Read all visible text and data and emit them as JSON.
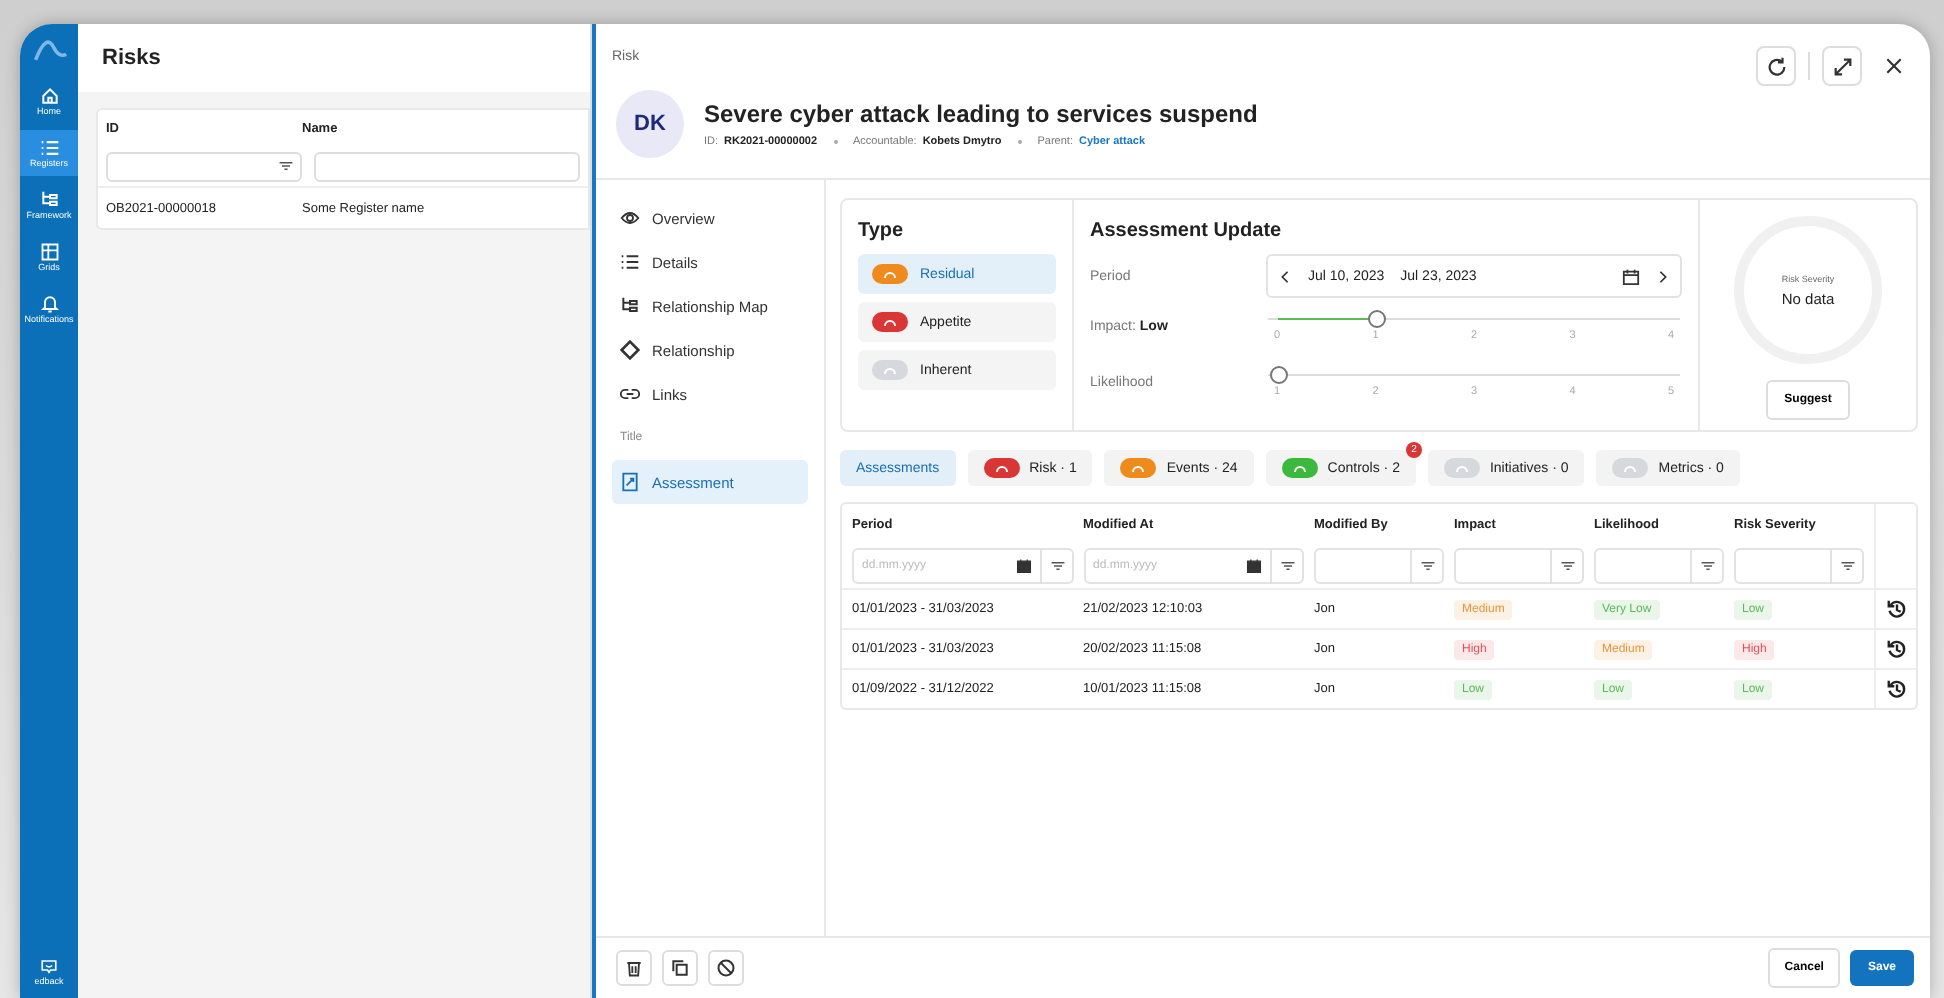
{
  "rail": {
    "items": [
      {
        "label": "Home",
        "selected": false
      },
      {
        "label": "Registers",
        "selected": true
      },
      {
        "label": "Framework",
        "selected": false
      },
      {
        "label": "Grids",
        "selected": false
      },
      {
        "label": "Notifications",
        "selected": false
      }
    ],
    "feedback": "edback"
  },
  "register": {
    "title": "Risks",
    "columns": [
      "ID",
      "Name"
    ],
    "rows": [
      [
        "OB2021-00000018",
        "Some Register name"
      ]
    ]
  },
  "drawer": {
    "caption": "Risk",
    "avatar": "DK",
    "title": "Severe cyber attack leading to services suspend",
    "meta": [
      {
        "label": "ID:",
        "value": "RK2021-00000002",
        "link": false
      },
      {
        "label": "Accountable:",
        "value": "Kobets Dmytro",
        "link": false
      },
      {
        "label": "Parent:",
        "value": "Cyber attack",
        "link": true
      }
    ],
    "nav": [
      {
        "label": "Overview",
        "kind": "item",
        "selected": false
      },
      {
        "label": "Details",
        "kind": "item",
        "selected": false
      },
      {
        "label": "Relationship Map",
        "kind": "item",
        "selected": false
      },
      {
        "label": "Relationship",
        "kind": "item",
        "selected": false
      },
      {
        "label": "Links",
        "kind": "item",
        "selected": false
      },
      {
        "label": "Title",
        "kind": "heading"
      },
      {
        "label": "Assessment",
        "kind": "item",
        "selected": true
      }
    ],
    "type": {
      "title": "Type",
      "items": [
        {
          "label": "Residual",
          "color": "#ef8a1c",
          "selected": true
        },
        {
          "label": "Appetite",
          "color": "#d93636",
          "selected": false
        },
        {
          "label": "Inherent",
          "color": "#d5d8dc",
          "selected": false
        }
      ]
    },
    "update": {
      "title": "Assessment Update",
      "period_label": "Period",
      "date_from": "Jul 10, 2023",
      "date_to": "Jul 23, 2023",
      "sliders": [
        {
          "label": "Impact:",
          "value": "Low",
          "level": 0.25,
          "ticks": [
            "0",
            "1",
            "2",
            "3",
            "4"
          ]
        },
        {
          "label": "Likelihood",
          "level": 0,
          "ticks": [
            "1",
            "2",
            "3",
            "4",
            "5"
          ]
        }
      ]
    },
    "severity": {
      "label": "Risk Severity",
      "value": "No data",
      "button": "Suggest"
    },
    "tabs": [
      {
        "label": "Assessments",
        "selected": true
      },
      {
        "label": "Risk · 1",
        "color": "#d93636",
        "selected": false
      },
      {
        "label": "Events · 24",
        "color": "#ef8a1c",
        "selected": false
      },
      {
        "label": "Controls · 2",
        "color": "#3cb83c",
        "badge": "2",
        "selected": false
      },
      {
        "label": "Initiatives · 0",
        "color": "#d5d8dc",
        "selected": false
      },
      {
        "label": "Metrics · 0",
        "color": "#d5d8dc",
        "selected": false
      }
    ],
    "table": {
      "columns": [
        {
          "label": "Period",
          "placeholder": "dd.mm.yyyy",
          "kind": "date"
        },
        {
          "label": "Modified At",
          "placeholder": "dd.mm.yyyy",
          "kind": "date"
        },
        {
          "label": "Modified By",
          "kind": "text"
        },
        {
          "label": "Impact",
          "kind": "text"
        },
        {
          "label": "Likelihood",
          "kind": "text"
        },
        {
          "label": "Risk Severity",
          "kind": "text"
        }
      ],
      "rows": [
        {
          "period": "01/01/2023 - 31/03/2023",
          "modified_at": "21/02/2023 12:10:03",
          "by": "Jon",
          "impact": {
            "text": "Medium",
            "color": "#e8953a"
          },
          "likelihood": {
            "text": "Very Low",
            "color": "#5cb85c"
          },
          "severity": {
            "text": "Low",
            "color": "#5cb85c"
          }
        },
        {
          "period": "01/01/2023 - 31/03/2023",
          "modified_at": "20/02/2023 11:15:08",
          "by": "Jon",
          "impact": {
            "text": "High",
            "color": "#e0505a"
          },
          "likelihood": {
            "text": "Medium",
            "color": "#e8953a"
          },
          "severity": {
            "text": "High",
            "color": "#e0505a"
          }
        },
        {
          "period": "01/09/2022 - 31/12/2022",
          "modified_at": "10/01/2023 11:15:08",
          "by": "Jon",
          "impact": {
            "text": "Low",
            "color": "#5cb85c"
          },
          "likelihood": {
            "text": "Low",
            "color": "#5cb85c"
          },
          "severity": {
            "text": "Low",
            "color": "#5cb85c"
          }
        }
      ]
    },
    "footer": {
      "cancel": "Cancel",
      "save": "Save"
    }
  }
}
